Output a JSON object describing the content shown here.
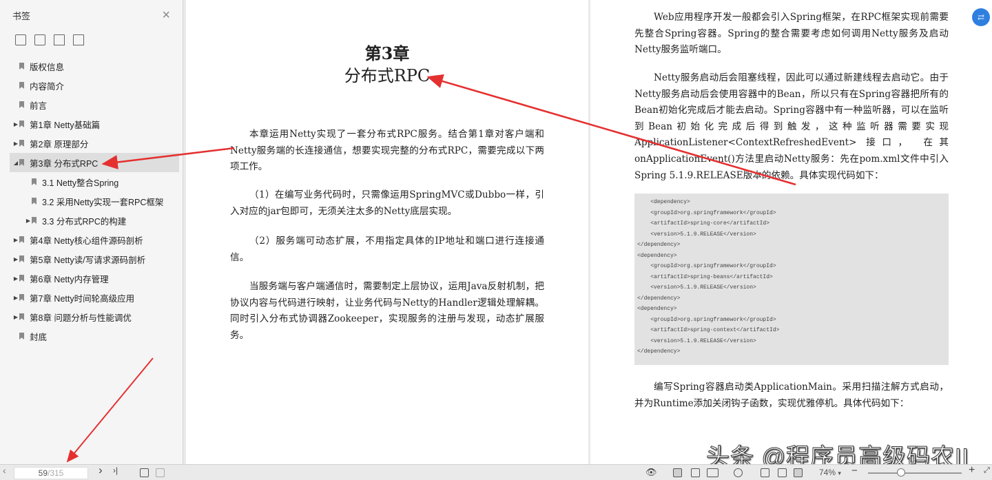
{
  "sidebar": {
    "title": "书签",
    "close": "×",
    "items": [
      {
        "label": "版权信息",
        "level": 0,
        "expander": ""
      },
      {
        "label": "内容简介",
        "level": 0,
        "expander": ""
      },
      {
        "label": "前言",
        "level": 0,
        "expander": ""
      },
      {
        "label": "第1章 Netty基础篇",
        "level": 0,
        "expander": "▶"
      },
      {
        "label": "第2章 原理部分",
        "level": 0,
        "expander": "▶"
      },
      {
        "label": "第3章 分布式RPC",
        "level": 0,
        "expander": "◢",
        "active": true
      },
      {
        "label": "3.1 Netty整合Spring",
        "level": 1,
        "expander": ""
      },
      {
        "label": "3.2 采用Netty实现一套RPC框架",
        "level": 1,
        "expander": ""
      },
      {
        "label": "3.3 分布式RPC的构建",
        "level": 1,
        "expander": "▶"
      },
      {
        "label": "第4章 Netty核心组件源码剖析",
        "level": 0,
        "expander": "▶"
      },
      {
        "label": "第5章 Netty读/写请求源码剖析",
        "level": 0,
        "expander": "▶"
      },
      {
        "label": "第6章 Netty内存管理",
        "level": 0,
        "expander": "▶"
      },
      {
        "label": "第7章 Netty时间轮高级应用",
        "level": 0,
        "expander": "▶"
      },
      {
        "label": "第8章 问题分析与性能调优",
        "level": 0,
        "expander": "▶"
      },
      {
        "label": "封底",
        "level": 0,
        "expander": ""
      }
    ]
  },
  "left_page": {
    "chapter_number": "第3章",
    "chapter_title": "分布式RPC",
    "para1": "本章运用Netty实现了一套分布式RPC服务。结合第1章对客户端和Netty服务端的长连接通信，想要实现完整的分布式RPC，需要完成以下两项工作。",
    "para2": "（1）在编写业务代码时，只需像运用SpringMVC或Dubbo一样，引入对应的jar包即可，无须关注太多的Netty底层实现。",
    "para3": "（2）服务端可动态扩展，不用指定具体的IP地址和端口进行连接通信。",
    "para4": "当服务端与客户端通信时，需要制定上层协议，运用Java反射机制，把协议内容与代码进行映射，让业务代码与Netty的Handler逻辑处理解耦。同时引入分布式协调器Zookeeper，实现服务的注册与发现，动态扩展服务。"
  },
  "right_page": {
    "para1": "Web应用程序开发一般都会引入Spring框架，在RPC框架实现前需要先整合Spring容器。Spring的整合需要考虑如何调用Netty服务及启动Netty服务监听端口。",
    "para2": "Netty服务启动后会阻塞线程，因此可以通过新建线程去启动它。由于Netty服务启动后会使用容器中的Bean，所以只有在Spring容器把所有的Bean初始化完成后才能去启动。Spring容器中有一种监听器，可以在监听到Bean初始化完成后得到触发，这种监听器需要实现ApplicationListener<ContextRefreshedEvent> 接口， 在其onApplicationEvent()方法里启动Netty服务：先在pom.xml文件中引入Spring 5.1.9.RELEASE版本的依赖。具体实现代码如下：",
    "code": [
      "    <dependency>",
      "    <groupId>org.springframework</groupId>",
      "    <artifactId>spring-core</artifactId>",
      "    <version>5.1.9.RELEASE</version>",
      "</dependency>",
      "<dependency>",
      "    <groupId>org.springframework</groupId>",
      "    <artifactId>spring-beans</artifactId>",
      "    <version>5.1.9.RELEASE</version>",
      "</dependency>",
      "<dependency>",
      "    <groupId>org.springframework</groupId>",
      "    <artifactId>spring-context</artifactId>",
      "    <version>5.1.9.RELEASE</version>",
      "</dependency>"
    ],
    "para3": "编写Spring容器启动类ApplicationMain。采用扫描注解方式启动，并为Runtime添加关闭钩子函数，实现优雅停机。具体代码如下："
  },
  "watermark": "头条 @程序员高级码农II",
  "bottombar": {
    "current_page": "59",
    "total_pages": "/315",
    "prev": "‹",
    "next": "›",
    "last": "›|",
    "zoom": "74%",
    "zoom_caret": "▾",
    "minus": "−",
    "plus": "+"
  },
  "colors": {
    "accent": "#2f7fe0",
    "arrow": "#e53030"
  }
}
